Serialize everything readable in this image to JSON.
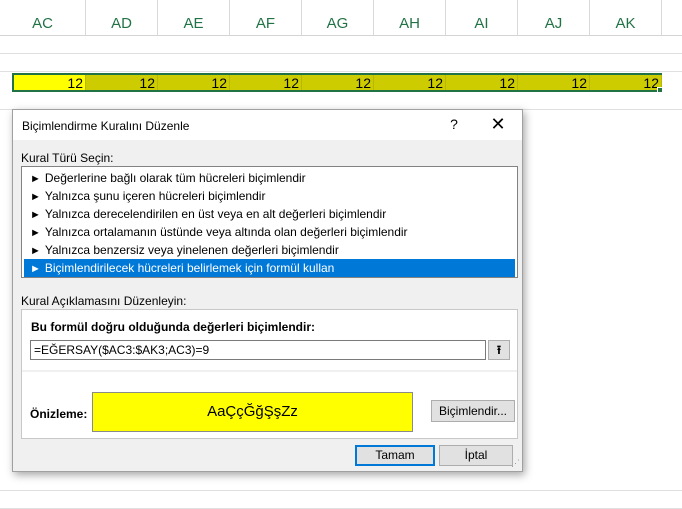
{
  "sheet": {
    "columns": [
      "AC",
      "AD",
      "AE",
      "AF",
      "AG",
      "AH",
      "AI",
      "AJ",
      "AK"
    ],
    "row_values": [
      "12",
      "12",
      "12",
      "12",
      "12",
      "12",
      "12",
      "12",
      "12"
    ]
  },
  "dialog": {
    "title": "Biçimlendirme Kuralını Düzenle",
    "help": "?",
    "close": "✕",
    "rule_type_label": "Kural Türü Seçin:",
    "rule_types": [
      "Değerlerine bağlı olarak tüm hücreleri biçimlendir",
      "Yalnızca şunu içeren hücreleri biçimlendir",
      "Yalnızca derecelendirilen en üst veya en alt değerleri biçimlendir",
      "Yalnızca ortalamanın üstünde veya altında olan değerleri biçimlendir",
      "Yalnızca benzersiz veya yinelenen değerleri biçimlendir",
      "Biçimlendirilecek hücreleri belirlemek için formül kullan"
    ],
    "selected_rule_index": 5,
    "description_label": "Kural Açıklamasını Düzenleyin:",
    "formula_label": "Bu formül doğru olduğunda değerleri biçimlendir:",
    "formula_value": "=EĞERSAY($AC3:$AK3;AC3)=9",
    "collapse_icon": "⭱",
    "preview_label": "Önizleme:",
    "preview_text": "AaÇçĞğŞşZz",
    "format_button": "Biçimlendir...",
    "ok_button": "Tamam",
    "cancel_button": "İptal",
    "colors": {
      "preview_fill": "#ffff00",
      "selection": "#0078d7",
      "header_text": "#217346"
    }
  }
}
